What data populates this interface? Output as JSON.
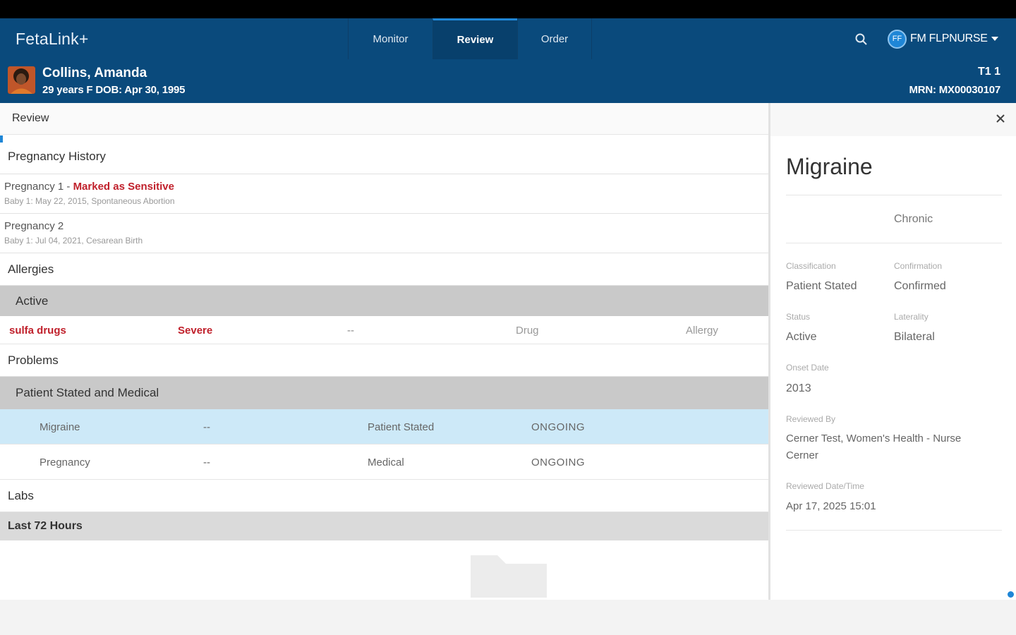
{
  "app": {
    "brand": "FetaLink+",
    "nav_tabs": [
      {
        "label": "Monitor",
        "active": false
      },
      {
        "label": "Review",
        "active": true
      },
      {
        "label": "Order",
        "active": false
      }
    ],
    "user": {
      "initials": "FF",
      "name": "FM FLPNURSE"
    }
  },
  "patient": {
    "name": "Collins, Amanda",
    "info": "29 years F DOB: Apr 30, 1995",
    "room": "T1 1",
    "mrn": "MRN: MX00030107"
  },
  "main": {
    "title": "Review",
    "pregnancy_history": {
      "title": "Pregnancy History",
      "items": [
        {
          "title": "Pregnancy 1 - ",
          "sensitive": "Marked as Sensitive",
          "sub": "Baby 1: May 22, 2015, Spontaneous Abortion"
        },
        {
          "title": "Pregnancy 2",
          "sensitive": "",
          "sub": "Baby 1: Jul 04, 2021, Cesarean Birth"
        }
      ]
    },
    "allergies": {
      "title": "Allergies",
      "group": "Active",
      "rows": [
        {
          "name": "sulfa drugs",
          "severity": "Severe",
          "reaction": "--",
          "type": "Drug",
          "category": "Allergy"
        }
      ]
    },
    "problems": {
      "title": "Problems",
      "group": "Patient Stated and Medical",
      "rows": [
        {
          "name": "Migraine",
          "dash": "--",
          "type": "Patient Stated",
          "status": "ONGOING",
          "selected": true
        },
        {
          "name": "Pregnancy",
          "dash": "--",
          "type": "Medical",
          "status": "ONGOING",
          "selected": false
        }
      ]
    },
    "labs": {
      "title": "Labs",
      "group": "Last 72 Hours"
    }
  },
  "detail": {
    "title": "Migraine",
    "chronicity": "Chronic",
    "fields": {
      "classification_label": "Classification",
      "classification_value": "Patient Stated",
      "confirmation_label": "Confirmation",
      "confirmation_value": "Confirmed",
      "status_label": "Status",
      "status_value": "Active",
      "laterality_label": "Laterality",
      "laterality_value": "Bilateral",
      "onset_label": "Onset Date",
      "onset_value": "2013",
      "reviewed_by_label": "Reviewed By",
      "reviewed_by_line1": "Cerner Test, Women's Health - Nurse",
      "reviewed_by_line2": "Cerner",
      "reviewed_dt_label": "Reviewed Date/Time",
      "reviewed_dt_value": "Apr 17, 2025 15:01"
    }
  },
  "colors": {
    "header": "#0a4a7c",
    "accent": "#1f86d6",
    "sensitive_red": "#c0202b",
    "selected_row": "#cde9f8",
    "group_bar": "#c9c9c9"
  }
}
